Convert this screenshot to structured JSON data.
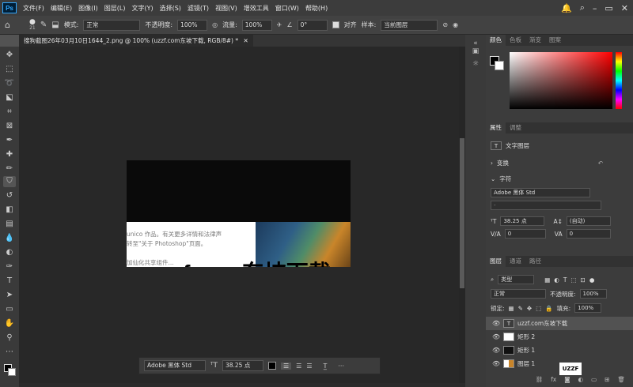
{
  "app": {
    "logo": "Ps"
  },
  "menu": [
    "文件(F)",
    "编辑(E)",
    "图像(I)",
    "图层(L)",
    "文字(Y)",
    "选择(S)",
    "滤镜(T)",
    "视图(V)",
    "增效工具",
    "窗口(W)",
    "帮助(H)"
  ],
  "options": {
    "size": "21",
    "mode_label": "模式:",
    "mode_value": "正常",
    "opacity_label": "不透明度:",
    "opacity_value": "100%",
    "flow_label": "流量:",
    "flow_value": "100%",
    "angle_value": "0°",
    "align_label": "对齐",
    "sample_label": "样本:",
    "sample_value": "当前图层"
  },
  "document": {
    "tab_title": "搜狗截图26年03月10日1644_2.png @ 100% (uzzf.com东坡下载, RGB/8#) *",
    "text_lines": [
      "unico 作品。有关更多详情和法律声",
      "转至\"关于 Photoshop\"页面。",
      "加仙化共享组件..."
    ],
    "overlay_text": "uzzf.com东坡下载"
  },
  "context_bar": {
    "font": "Adobe 黑体 Std",
    "size": "38.25 点"
  },
  "color_panel": {
    "tabs": [
      "颜色",
      "色板",
      "渐变",
      "图案"
    ]
  },
  "properties_panel": {
    "tabs": [
      "属性",
      "调整"
    ],
    "type_label": "文字图层",
    "transform_label": "变换",
    "character_label": "字符",
    "font": "Adobe 黑体 Std",
    "style": "-",
    "size": "38.25 点",
    "leading": "(自动)",
    "kerning": "0",
    "tracking": "0"
  },
  "layers_panel": {
    "tabs": [
      "图层",
      "通道",
      "路径"
    ],
    "filter": "类型",
    "blend_mode": "正常",
    "opacity_label": "不透明度:",
    "opacity_value": "100%",
    "lock_label": "锁定:",
    "fill_label": "填充:",
    "fill_value": "100%",
    "layers": [
      "uzzf.com东坡下载",
      "矩形 2",
      "矩形 1",
      "图层 1"
    ],
    "badge": "UZZF"
  },
  "colors": {
    "accent": "#31a8ff",
    "background": "#535353",
    "panel": "#3c3c3c"
  }
}
